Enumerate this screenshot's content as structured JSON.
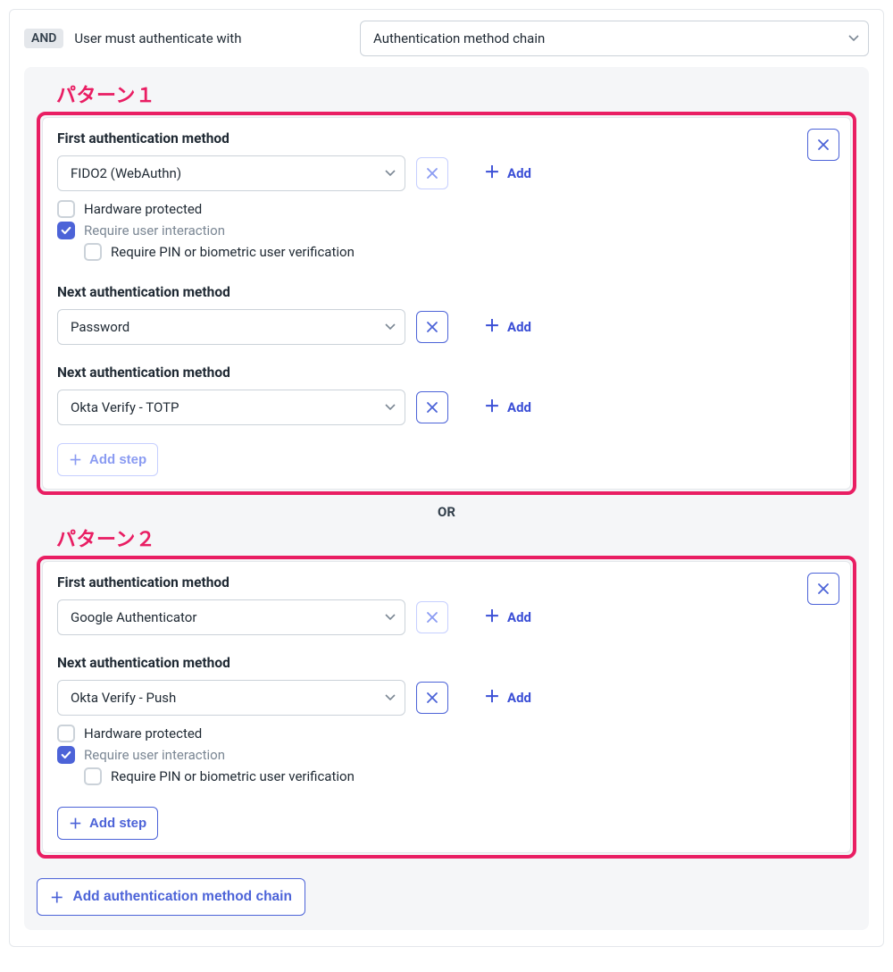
{
  "header": {
    "and_badge": "AND",
    "label": "User must authenticate with",
    "select_value": "Authentication method chain"
  },
  "or_label": "OR",
  "add_chain_label": "Add authentication method chain",
  "patterns": [
    {
      "title": "パターン１",
      "add_step_label": "Add step",
      "add_step_muted": true,
      "steps": [
        {
          "label": "First authentication method",
          "value": "FIDO2 (WebAuthn)",
          "remove_muted": true,
          "add_label": "Add",
          "options": [
            {
              "label": "Hardware protected",
              "checked": false,
              "indent": false,
              "muted": false
            },
            {
              "label": "Require user interaction",
              "checked": true,
              "indent": false,
              "muted": true
            },
            {
              "label": "Require PIN or biometric user verification",
              "checked": false,
              "indent": true,
              "muted": false
            }
          ]
        },
        {
          "label": "Next authentication method",
          "value": "Password",
          "remove_muted": false,
          "add_label": "Add",
          "options": []
        },
        {
          "label": "Next authentication method",
          "value": "Okta Verify - TOTP",
          "remove_muted": false,
          "add_label": "Add",
          "options": []
        }
      ]
    },
    {
      "title": "パターン２",
      "add_step_label": "Add step",
      "add_step_muted": false,
      "steps": [
        {
          "label": "First authentication method",
          "value": "Google Authenticator",
          "remove_muted": true,
          "add_label": "Add",
          "options": []
        },
        {
          "label": "Next authentication method",
          "value": "Okta Verify - Push",
          "remove_muted": false,
          "add_label": "Add",
          "options": [
            {
              "label": "Hardware protected",
              "checked": false,
              "indent": false,
              "muted": false
            },
            {
              "label": "Require user interaction",
              "checked": true,
              "indent": false,
              "muted": true
            },
            {
              "label": "Require PIN or biometric user verification",
              "checked": false,
              "indent": true,
              "muted": false
            }
          ]
        }
      ]
    }
  ]
}
